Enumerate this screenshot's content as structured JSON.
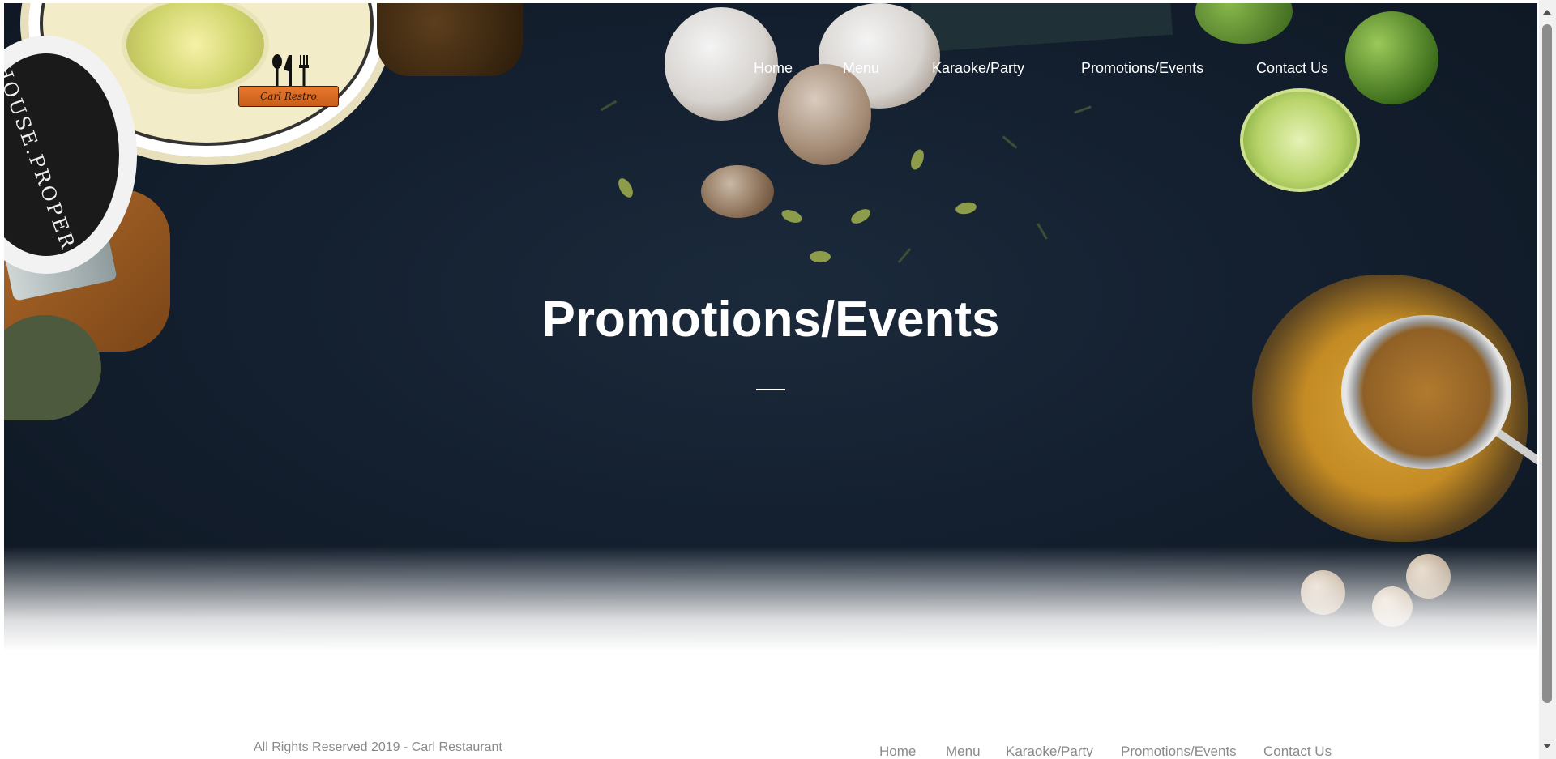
{
  "brand": {
    "logo_text": "Carl Restro"
  },
  "nav": {
    "items": [
      "Home",
      "Menu",
      "Karaoke/Party",
      "Promotions/Events",
      "Contact Us"
    ]
  },
  "hero": {
    "title": "Promotions/Events"
  },
  "jar_text": "HOUSE.PROPER",
  "footer": {
    "copyright": "All Rights Reserved 2019 - Carl Restaurant",
    "nav": [
      "Home",
      "Menu",
      "Karaoke/Party",
      "Promotions/Events",
      "Contact Us"
    ]
  },
  "colors": {
    "hero_bg": "#142030",
    "nav_text": "#ffffff",
    "footer_text": "#8a8a8a",
    "logo_banner": "#e8792e"
  }
}
